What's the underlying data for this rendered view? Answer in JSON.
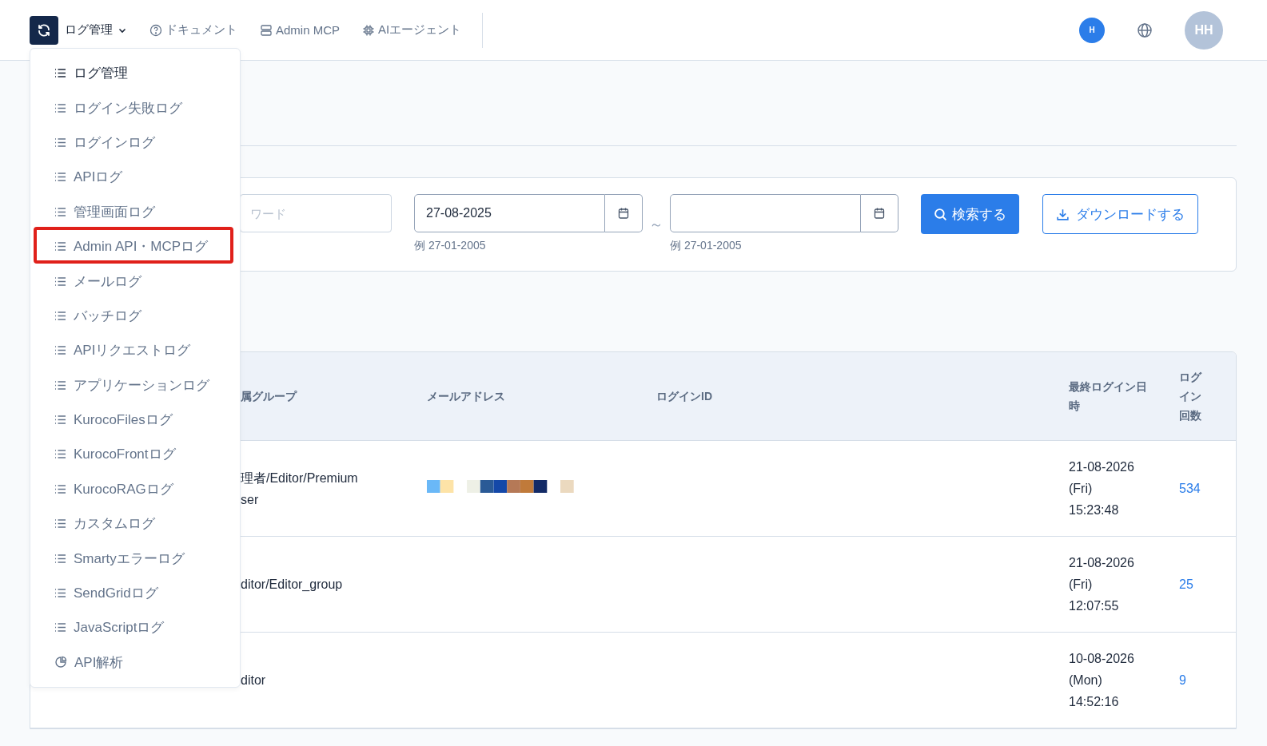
{
  "header": {
    "menu_label": "ログ管理",
    "nav": [
      {
        "kind": "help",
        "label": "ドキュメント"
      },
      {
        "kind": "server",
        "label": "Admin MCP"
      },
      {
        "kind": "chip",
        "label": "AIエージェント"
      }
    ],
    "badge": "H",
    "avatar": "HH"
  },
  "dropdown": [
    {
      "kind": "list",
      "label": "ログ管理",
      "selected": true,
      "highlighted": false
    },
    {
      "kind": "list",
      "label": "ログイン失敗ログ",
      "selected": false,
      "highlighted": false
    },
    {
      "kind": "list",
      "label": "ログインログ",
      "selected": false,
      "highlighted": false
    },
    {
      "kind": "list",
      "label": "APIログ",
      "selected": false,
      "highlighted": false
    },
    {
      "kind": "list",
      "label": "管理画面ログ",
      "selected": false,
      "highlighted": false
    },
    {
      "kind": "list",
      "label": "Admin API・MCPログ",
      "selected": false,
      "highlighted": true
    },
    {
      "kind": "list",
      "label": "メールログ",
      "selected": false,
      "highlighted": false
    },
    {
      "kind": "list",
      "label": "バッチログ",
      "selected": false,
      "highlighted": false
    },
    {
      "kind": "list",
      "label": "APIリクエストログ",
      "selected": false,
      "highlighted": false
    },
    {
      "kind": "list",
      "label": "アプリケーションログ",
      "selected": false,
      "highlighted": false
    },
    {
      "kind": "list",
      "label": "KurocoFilesログ",
      "selected": false,
      "highlighted": false
    },
    {
      "kind": "list",
      "label": "KurocoFrontログ",
      "selected": false,
      "highlighted": false
    },
    {
      "kind": "list",
      "label": "KurocoRAGログ",
      "selected": false,
      "highlighted": false
    },
    {
      "kind": "list",
      "label": "カスタムログ",
      "selected": false,
      "highlighted": false
    },
    {
      "kind": "list",
      "label": "Smartyエラーログ",
      "selected": false,
      "highlighted": false
    },
    {
      "kind": "list",
      "label": "SendGridログ",
      "selected": false,
      "highlighted": false
    },
    {
      "kind": "list",
      "label": "JavaScriptログ",
      "selected": false,
      "highlighted": false
    },
    {
      "kind": "chart",
      "label": "API解析",
      "selected": false,
      "highlighted": false
    }
  ],
  "search": {
    "keyword": {
      "placeholder": "ワード"
    },
    "date_from": {
      "value": "27-08-2025",
      "hint": "例 27-01-2005"
    },
    "separator": "～",
    "date_to": {
      "hint": "例 27-01-2005"
    },
    "search_button": "検索する",
    "download_button": "ダウンロードする"
  },
  "table": {
    "columns": [
      "属グループ",
      "メールアドレス",
      "ログインID",
      "最終ログイン日時",
      "ログイン回数"
    ],
    "rows": [
      {
        "group": [
          "理者/Editor/Premium",
          "ser"
        ],
        "email": {
          "kind": "picture"
        },
        "last_login": [
          "21-08-2026",
          "(Fri)",
          "15:23:48"
        ],
        "count": "534"
      },
      {
        "group": [
          "ditor/Editor_group"
        ],
        "last_login": [
          "21-08-2026",
          "(Fri)",
          "12:07:55"
        ],
        "count": "25"
      },
      {
        "group": [
          "ditor"
        ],
        "last_login": [
          "10-08-2026",
          "(Mon)",
          "14:52:16"
        ],
        "count": "9"
      }
    ]
  }
}
